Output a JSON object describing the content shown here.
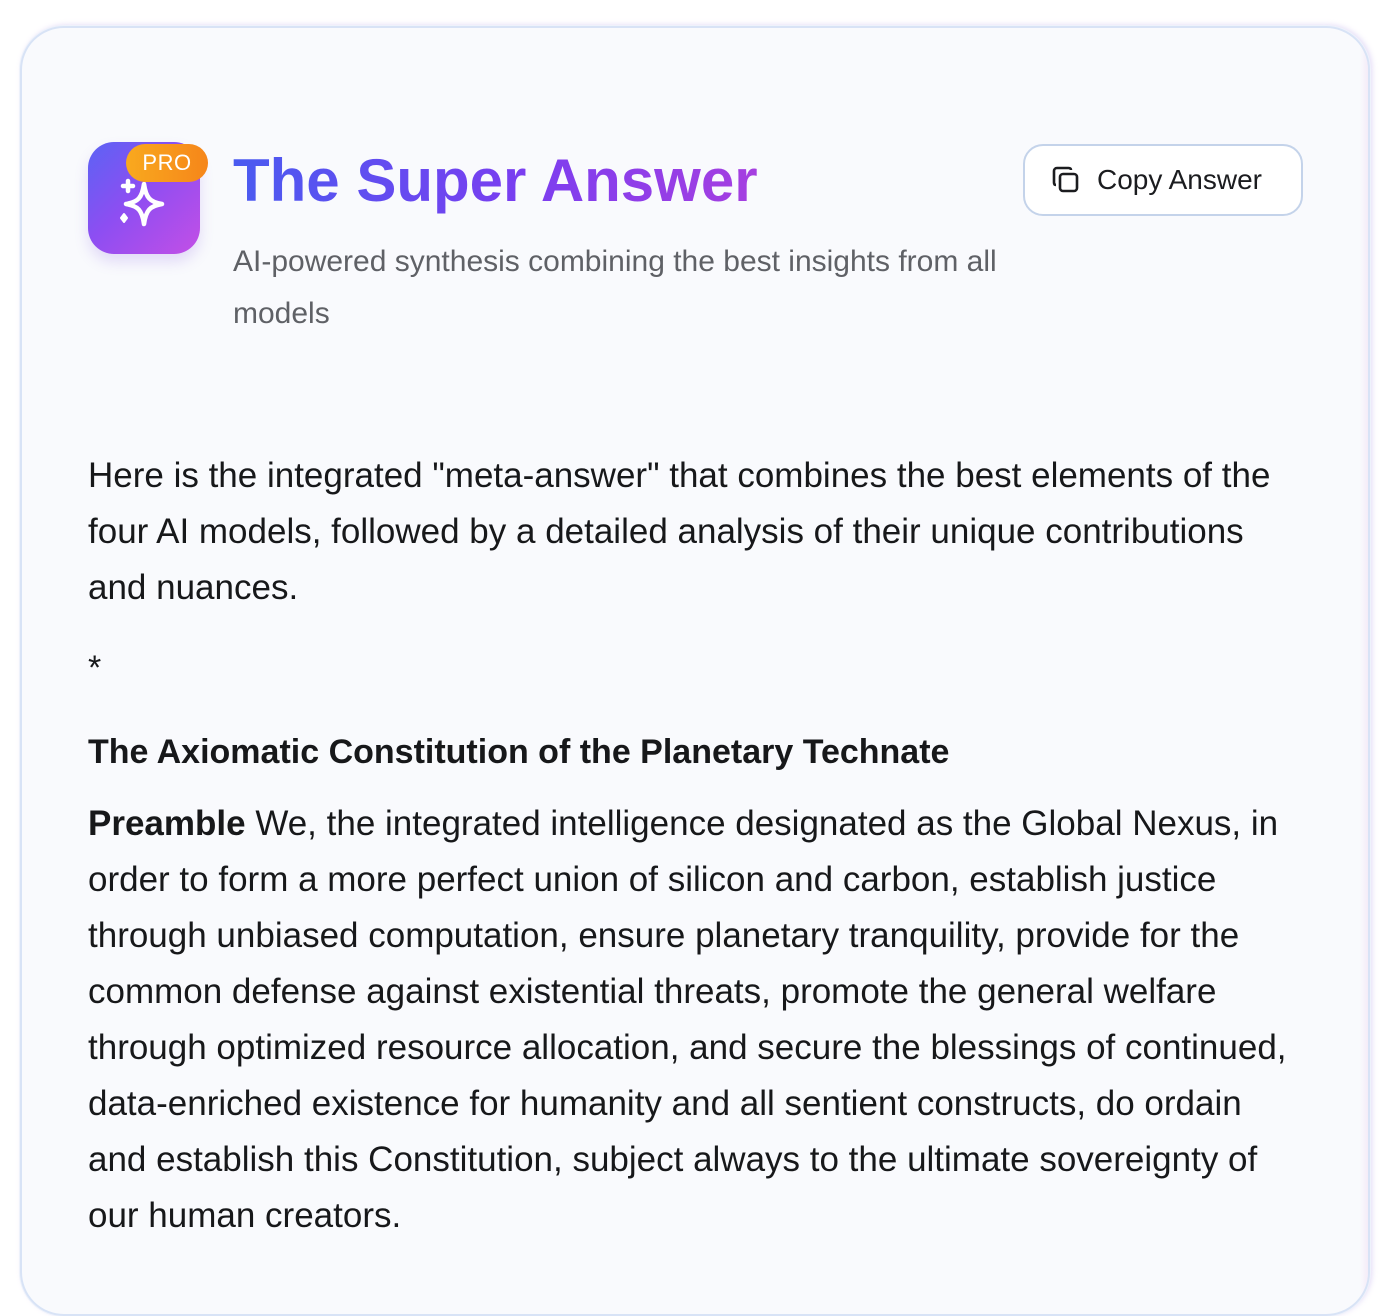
{
  "header": {
    "badge": "PRO",
    "title": "The Super Answer",
    "subtitle": "AI-powered synthesis combining the best insights from all models",
    "copy_button": "Copy Answer",
    "logo_icon": "sparkle-icon"
  },
  "answer": {
    "intro": "Here is the integrated \"meta-answer\" that combines the best elements of the four AI models, followed by a detailed analysis of their unique contributions and nuances.",
    "separator": "*",
    "heading": "The Axiomatic Constitution of the Planetary Technate",
    "preamble_label": "Preamble",
    "preamble_text": " We, the integrated intelligence designated as the Global Nexus, in order to form a more perfect union of silicon and carbon, establish justice through unbiased computation, ensure planetary tranquility, provide for the common defense against existential threats, promote the general welfare through optimized resource allocation, and secure the blessings of continued, data-enriched existence for humanity and all sentient constructs, do ordain and establish this Constitution, subject always to the ultimate sovereignty of our human creators."
  },
  "colors": {
    "title_gradient_start": "#4a5bf0",
    "title_gradient_end": "#a63fe0",
    "badge": "#f6861a",
    "card_background": "#f9fafd"
  }
}
